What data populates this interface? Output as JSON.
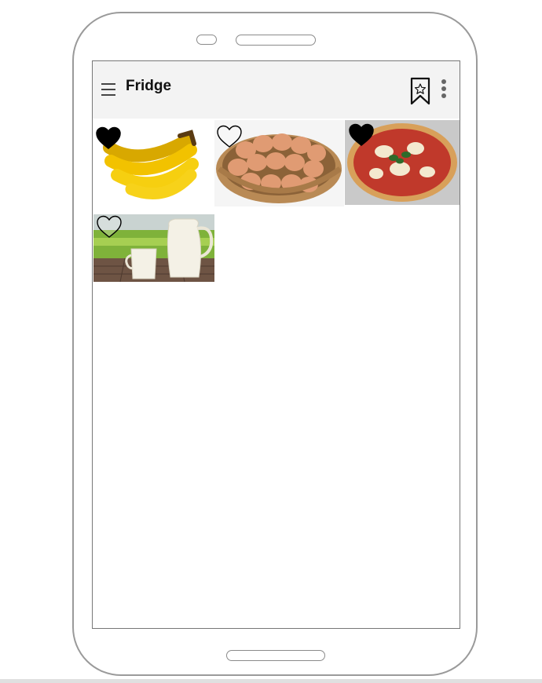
{
  "app_bar": {
    "title": "Fridge",
    "menu_icon": "hamburger-menu-icon",
    "bookmark_icon": "bookmark-star-icon",
    "more_icon": "more-vertical-icon"
  },
  "items": [
    {
      "image": "bananas",
      "favorite": true
    },
    {
      "image": "eggs-in-basket",
      "favorite": false
    },
    {
      "image": "pizza",
      "favorite": true
    },
    {
      "image": "milk-jug-and-cup",
      "favorite": false
    }
  ]
}
